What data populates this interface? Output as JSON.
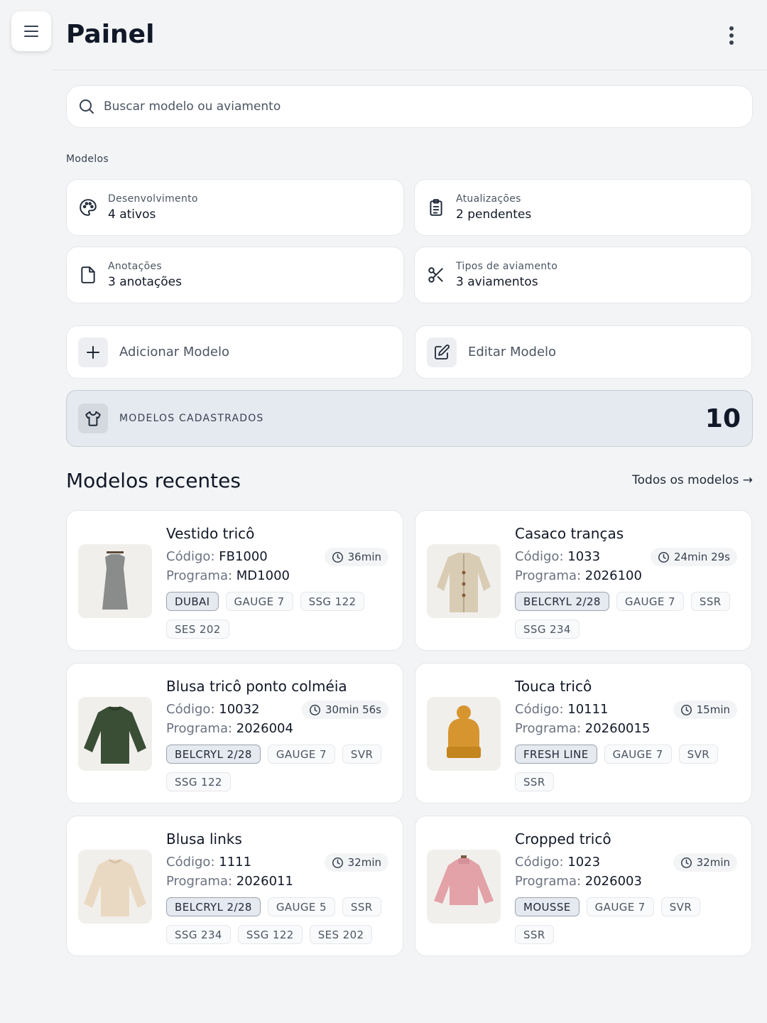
{
  "header": {
    "title": "Painel"
  },
  "search": {
    "placeholder": "Buscar modelo ou aviamento"
  },
  "section_label": "Modelos",
  "stats": [
    {
      "label": "Desenvolvimento",
      "value": "4 ativos",
      "icon": "palette-icon"
    },
    {
      "label": "Atualizações",
      "value": "2 pendentes",
      "icon": "clipboard-icon"
    },
    {
      "label": "Anotações",
      "value": "3 anotações",
      "icon": "file-icon"
    },
    {
      "label": "Tipos de aviamento",
      "value": "3 aviamentos",
      "icon": "scissors-icon"
    }
  ],
  "actions": [
    {
      "label": "Adicionar Modelo",
      "icon": "plus-icon"
    },
    {
      "label": "Editar Modelo",
      "icon": "edit-icon"
    }
  ],
  "total": {
    "label": "MODELOS CADASTRADOS",
    "value": "10",
    "icon": "shirt-icon"
  },
  "recent": {
    "title": "Modelos recentes",
    "see_all": "Todos os modelos →",
    "code_label": "Código:",
    "program_label": "Programa:",
    "items": [
      {
        "name": "Vestido tricô",
        "code": "FB1000",
        "program": "MD1000",
        "time": "36min",
        "tags": [
          "DUBAI",
          "GAUGE 7",
          "SSG 122",
          "SES 202"
        ],
        "color": "#8a8c8c"
      },
      {
        "name": "Casaco tranças",
        "code": "1033",
        "program": "2026100",
        "time": "24min 29s",
        "tags": [
          "BELCRYL 2/28",
          "GAUGE 7",
          "SSR",
          "SSG 234"
        ],
        "color": "#d9ccb4"
      },
      {
        "name": "Blusa tricô ponto colméia",
        "code": "10032",
        "program": "2026004",
        "time": "30min 56s",
        "tags": [
          "BELCRYL 2/28",
          "GAUGE 7",
          "SVR",
          "SSG 122"
        ],
        "color": "#3a4e36"
      },
      {
        "name": "Touca tricô",
        "code": "10111",
        "program": "20260015",
        "time": "15min",
        "tags": [
          "FRESH LINE",
          "GAUGE 7",
          "SVR",
          "SSR"
        ],
        "color": "#d6952e"
      },
      {
        "name": "Blusa links",
        "code": "1111",
        "program": "2026011",
        "time": "32min",
        "tags": [
          "BELCRYL 2/28",
          "GAUGE 5",
          "SSR",
          "SSG 234",
          "SSG 122",
          "SES 202"
        ],
        "color": "#ead9c2"
      },
      {
        "name": "Cropped tricô",
        "code": "1023",
        "program": "2026003",
        "time": "32min",
        "tags": [
          "MOUSSE",
          "GAUGE 7",
          "SVR",
          "SSR"
        ],
        "color": "#e2a2a7"
      }
    ]
  }
}
